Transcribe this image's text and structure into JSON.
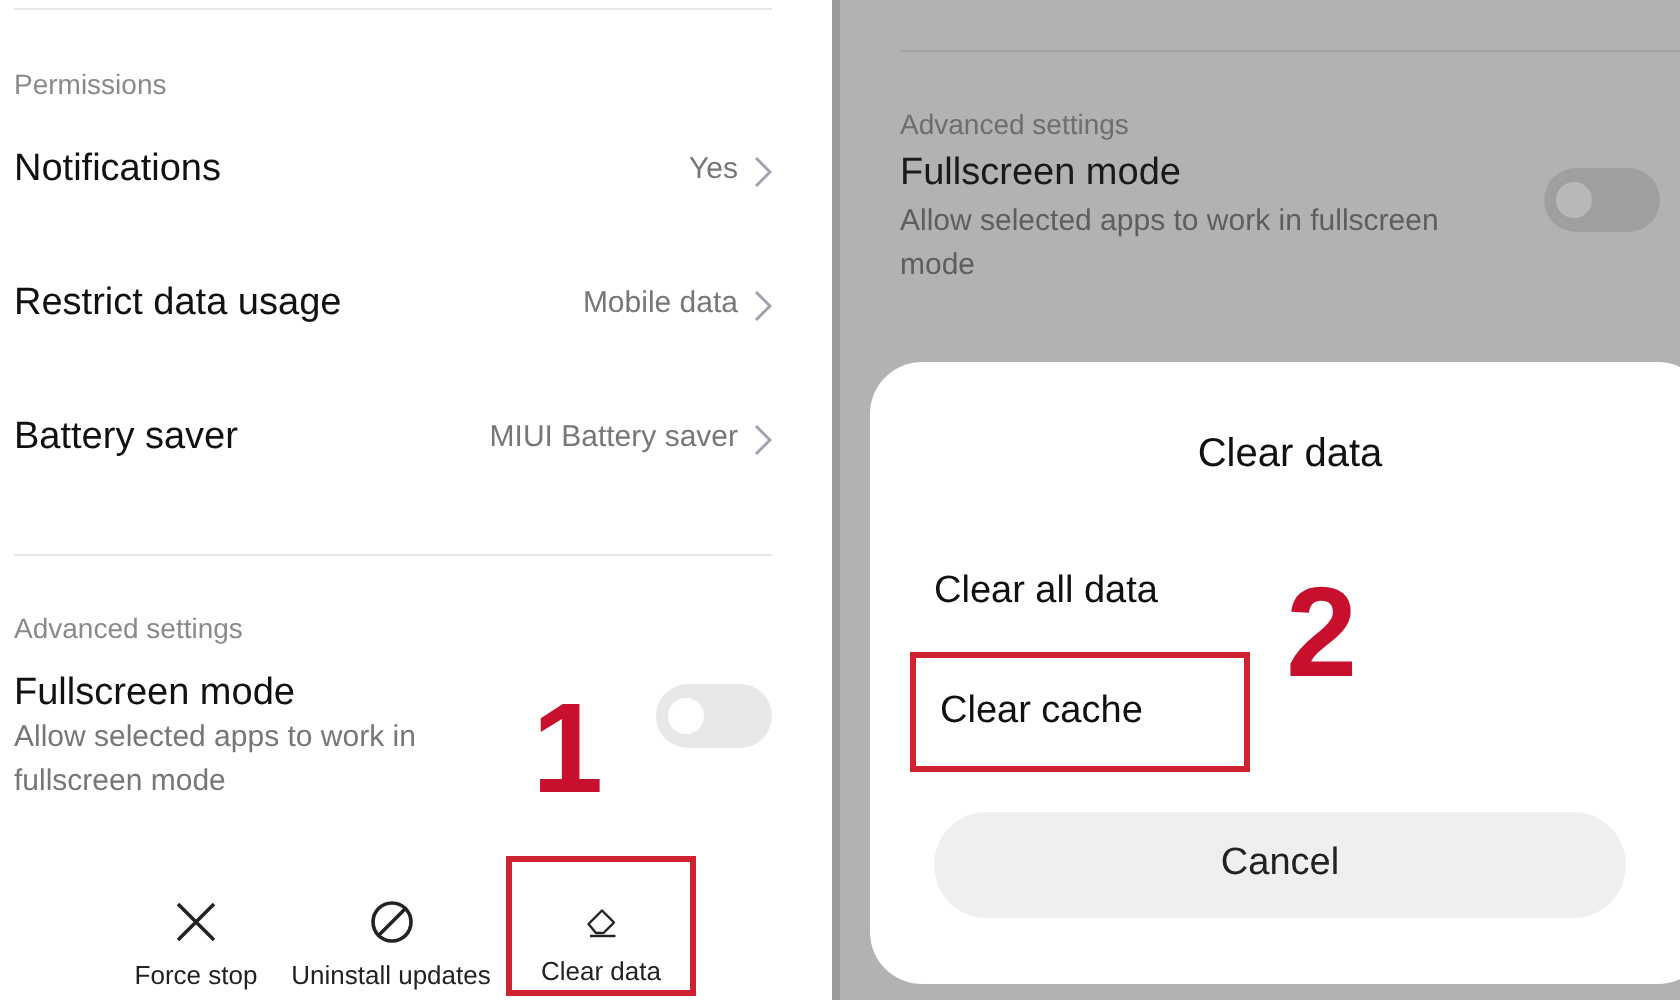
{
  "left_screen": {
    "sections": [
      {
        "heading": "Permissions",
        "rows": [
          {
            "label": "Notifications",
            "value": "Yes"
          },
          {
            "label": "Restrict data usage",
            "value": "Mobile data"
          },
          {
            "label": "Battery saver",
            "value": "MIUI Battery saver"
          }
        ]
      }
    ],
    "advanced": {
      "heading": "Advanced settings",
      "title": "Fullscreen mode",
      "description": "Allow selected apps to work in fullscreen mode",
      "on": false
    },
    "actions": [
      {
        "kind": "close",
        "label": "Force stop",
        "highlighted": false
      },
      {
        "kind": "block",
        "label": "Uninstall updates",
        "highlighted": false
      },
      {
        "kind": "eraser",
        "label": "Clear data",
        "highlighted": true
      }
    ],
    "step": "1"
  },
  "right_screen": {
    "advanced": {
      "heading": "Advanced settings",
      "title": "Fullscreen mode",
      "description": "Allow selected apps to work in fullscreen mode",
      "on": false
    },
    "dialog": {
      "title": "Clear data",
      "options": [
        {
          "label": "Clear all data",
          "highlighted": false
        },
        {
          "label": "Clear cache",
          "highlighted": true
        }
      ],
      "cancel": "Cancel"
    },
    "step": "2"
  }
}
